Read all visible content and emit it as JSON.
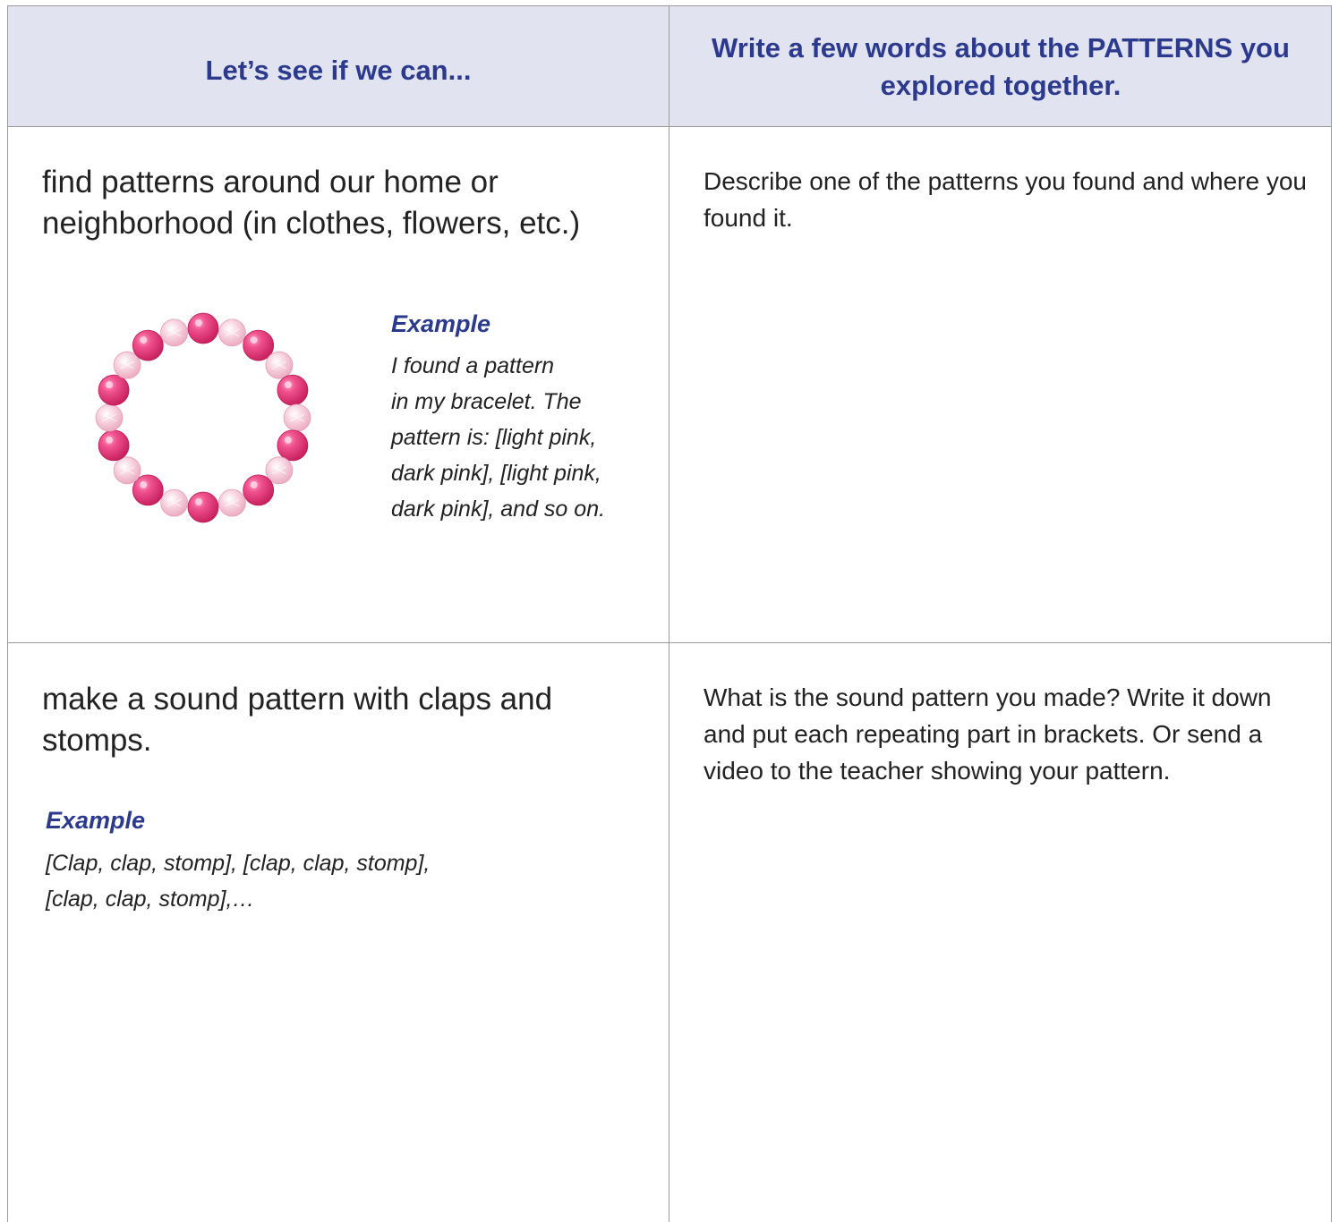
{
  "header": {
    "left_title": "Let’s see if we can...",
    "right_title": "Write a few words about the PATTERNS you explored together."
  },
  "rows": [
    {
      "task": "find patterns around our home or neighborhood (in clothes, flowers, etc.)",
      "example_label": "Example",
      "example_lines": [
        "I found a pattern",
        "in my bracelet. The",
        "pattern is: [light pink,",
        "dark pink], [light pink,",
        "dark pink], and so on."
      ],
      "prompt": "Describe one of the patterns you found and where you found it."
    },
    {
      "task": "make a sound pattern with claps and stomps.",
      "example_label": "Example",
      "example_lines": [
        "[Clap, clap, stomp], [clap, clap, stomp],",
        "[clap, clap, stomp],…"
      ],
      "prompt": "What is the sound pattern you made? Write it down and put each repeating part in brackets. Or send a video to the teacher showing your pattern."
    }
  ],
  "image": {
    "subject": "pink bead bracelet",
    "colors": {
      "dark_bead": "#e23d7f",
      "light_bead": "#f4c6d6"
    }
  },
  "colors": {
    "header_bg": "#e1e3f0",
    "accent": "#2b3a8c",
    "border": "#9a9a9a"
  }
}
